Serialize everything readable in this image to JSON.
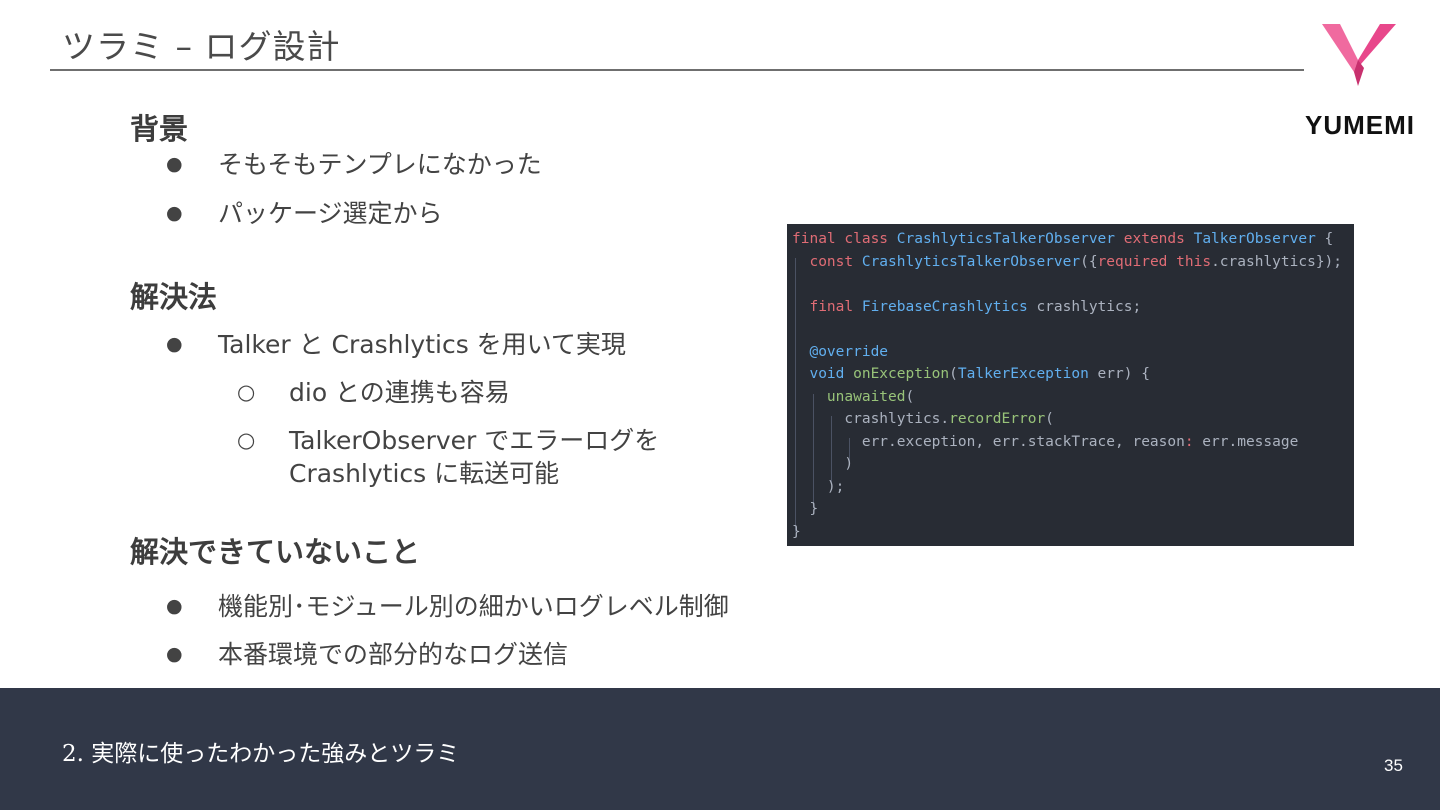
{
  "slide": {
    "title": "ツラミ – ログ設計",
    "logo_text": "YUMEMI",
    "brand_color": "#e8478b"
  },
  "sections": {
    "background": {
      "heading": "背景",
      "items": [
        "そもそもテンプレになかった",
        "パッケージ選定から"
      ]
    },
    "solution": {
      "heading": "解決法",
      "items": [
        {
          "text": "Talker と Crashlytics を用いて実現",
          "sub": [
            {
              "line1": "dio との連携も容易"
            },
            {
              "line1": "TalkerObserver でエラーログを",
              "line2": "Crashlytics に転送可能"
            }
          ]
        }
      ]
    },
    "unsolved": {
      "heading": "解決できていないこと",
      "items": [
        "機能別･モジュール別の細かいログレベル制御",
        "本番環境での部分的なログ送信"
      ]
    }
  },
  "bullet_markers": {
    "filled": "●",
    "hollow": "○"
  },
  "code": {
    "lines": [
      [
        {
          "t": "final class ",
          "c": "kw"
        },
        {
          "t": "CrashlyticsTalkerObserver ",
          "c": "cls"
        },
        {
          "t": "extends ",
          "c": "kw"
        },
        {
          "t": "TalkerObserver",
          "c": "cls"
        },
        {
          "t": " {",
          "c": "plain"
        }
      ],
      [
        {
          "t": "  const ",
          "c": "kw"
        },
        {
          "t": "CrashlyticsTalkerObserver",
          "c": "cls"
        },
        {
          "t": "({",
          "c": "plain"
        },
        {
          "t": "required this",
          "c": "kw"
        },
        {
          "t": ".crashlytics});",
          "c": "plain"
        }
      ],
      [],
      [
        {
          "t": "  final ",
          "c": "kw"
        },
        {
          "t": "FirebaseCrashlytics",
          "c": "cls"
        },
        {
          "t": " crashlytics;",
          "c": "plain"
        }
      ],
      [],
      [
        {
          "t": "  @override",
          "c": "cls"
        }
      ],
      [
        {
          "t": "  void ",
          "c": "cls"
        },
        {
          "t": "onException",
          "c": "fn"
        },
        {
          "t": "(",
          "c": "plain"
        },
        {
          "t": "TalkerException",
          "c": "cls"
        },
        {
          "t": " err) {",
          "c": "plain"
        }
      ],
      [
        {
          "t": "    unawaited",
          "c": "fn"
        },
        {
          "t": "(",
          "c": "plain"
        }
      ],
      [
        {
          "t": "      crashlytics.",
          "c": "plain"
        },
        {
          "t": "recordError",
          "c": "fn"
        },
        {
          "t": "(",
          "c": "plain"
        }
      ],
      [
        {
          "t": "        err.exception, err.stackTrace, reason",
          "c": "plain"
        },
        {
          "t": ":",
          "c": "kw"
        },
        {
          "t": " err.message",
          "c": "plain"
        }
      ],
      [
        {
          "t": "      )",
          "c": "plain"
        }
      ],
      [
        {
          "t": "    );",
          "c": "plain"
        }
      ],
      [
        {
          "t": "  }",
          "c": "plain"
        }
      ],
      [
        {
          "t": "}",
          "c": "plain"
        }
      ]
    ]
  },
  "footer": {
    "text": "2.  実際に使ったわかった強みとツラミ",
    "page_number": "35"
  }
}
